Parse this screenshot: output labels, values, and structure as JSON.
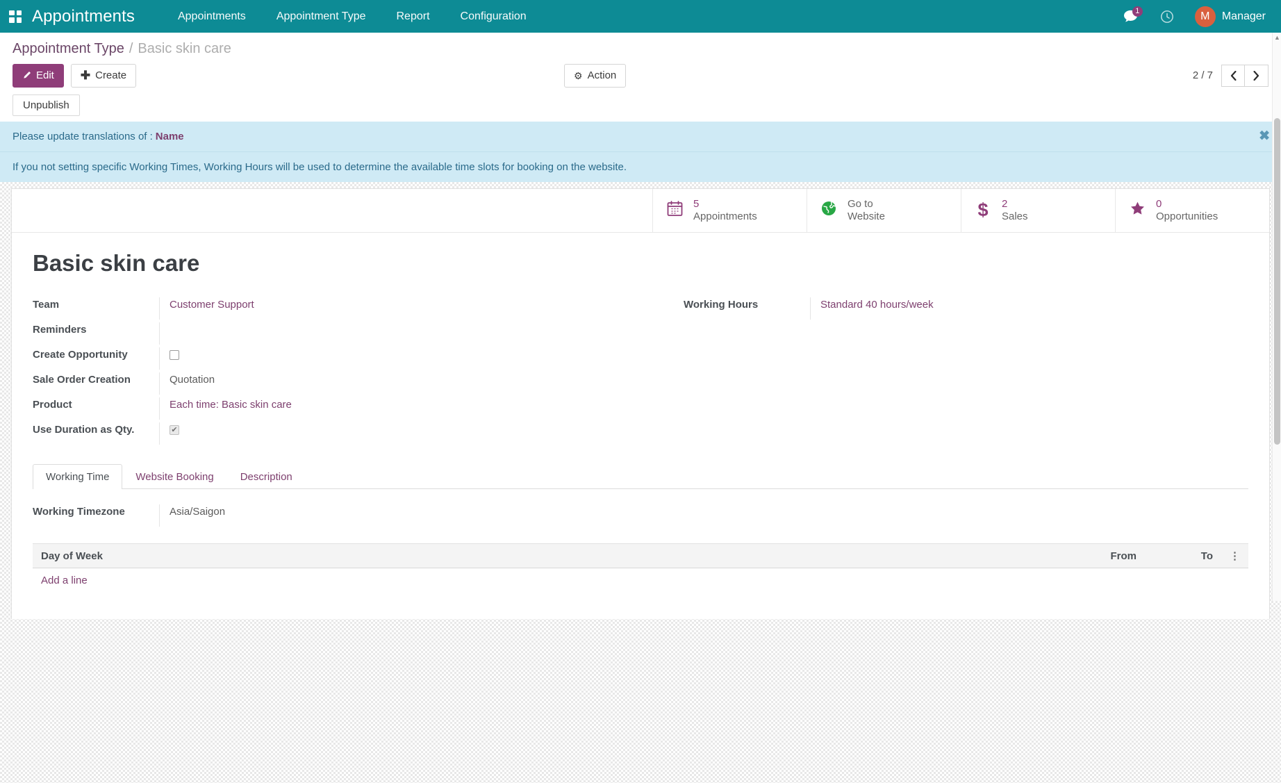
{
  "navbar": {
    "apps_icon": "apps-grid-icon",
    "brand": "Appointments",
    "menu": [
      {
        "label": "Appointments"
      },
      {
        "label": "Appointment Type"
      },
      {
        "label": "Report"
      },
      {
        "label": "Configuration"
      }
    ],
    "messaging_icon": "chat-bubble-icon",
    "messaging_count": "1",
    "activity_icon": "clock-icon",
    "avatar_initial": "M",
    "user_name": "Manager",
    "background_color": "#0d8b95"
  },
  "breadcrumb": {
    "parent": "Appointment Type",
    "separator": "/",
    "current": "Basic skin care"
  },
  "control_panel": {
    "edit_label": "Edit",
    "edit_icon": "pencil-icon",
    "create_label": "Create",
    "create_icon": "plus-icon",
    "action_label": "Action",
    "action_icon": "gear-icon",
    "pager_text": "2 / 7",
    "prev_icon": "chevron-left-icon",
    "next_icon": "chevron-right-icon",
    "edit_button_color": "#8f3d79"
  },
  "publish": {
    "unpublish_label": "Unpublish"
  },
  "alerts": [
    {
      "text": "Please update translations of :",
      "link": "Name",
      "close_icon": "close-icon",
      "background_color": "#cfeaf5"
    },
    {
      "text": "If you not setting specific Working Times, Working Hours will be used to determine the available time slots for booking on the website.",
      "background_color": "#cfeaf5"
    }
  ],
  "stat_buttons": [
    {
      "icon": "calendar-icon",
      "value": "5",
      "label": "Appointments",
      "label2": ""
    },
    {
      "icon": "globe-icon",
      "value": "Go to",
      "label": "Website",
      "label2": ""
    },
    {
      "icon": "dollar-icon",
      "value": "2",
      "label": "Sales",
      "label2": ""
    },
    {
      "icon": "star-icon",
      "value": "0",
      "label": "Opportunities",
      "label2": ""
    }
  ],
  "record": {
    "title": "Basic skin care",
    "fields_left": [
      {
        "label": "Team",
        "value": "Customer Support",
        "type": "link"
      },
      {
        "label": "Reminders",
        "value": "",
        "type": "text"
      },
      {
        "label": "Create Opportunity",
        "value": "",
        "type": "checkbox",
        "checked": false
      },
      {
        "label": "Sale Order Creation",
        "value": "Quotation",
        "type": "text"
      },
      {
        "label": "Product",
        "value": "Each time: Basic skin care",
        "type": "link"
      },
      {
        "label": "Use Duration as Qty.",
        "value": "",
        "type": "checkbox",
        "checked": true
      }
    ],
    "fields_right": [
      {
        "label": "Working Hours",
        "value": "Standard 40 hours/week",
        "type": "link"
      }
    ]
  },
  "tabs": [
    {
      "label": "Working Time",
      "active": true
    },
    {
      "label": "Website Booking",
      "active": false
    },
    {
      "label": "Description",
      "active": false
    }
  ],
  "working_time": {
    "timezone_label": "Working Timezone",
    "timezone_value": "Asia/Saigon",
    "columns": [
      "Day of Week",
      "From",
      "To"
    ],
    "options_icon": "vertical-dots-icon",
    "rows": [],
    "add_line_label": "Add a line"
  }
}
